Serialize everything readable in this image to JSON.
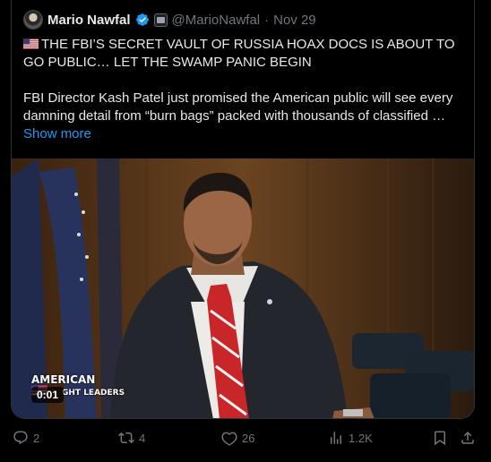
{
  "tweet": {
    "author_name": "Mario Nawfal",
    "handle": "@MarioNawfal",
    "separator": "·",
    "date": "Nov 29",
    "headline": "THE FBI’S SECRET VAULT OF RUSSIA HOAX DOCS IS ABOUT TO GO PUBLIC… LET THE SWAMP PANIC BEGIN",
    "paragraph": "FBI Director Kash Patel just promised the American public will see every damning detail from “burn bags” packed with thousands of classified …",
    "show_more": "Show more",
    "verified_icon": "verified-badge-icon",
    "affiliation_icon": "affiliation-badge-icon",
    "flag_icon": "us-flag-icon"
  },
  "video": {
    "timestamp": "0:01",
    "brand_line1": "AMERICAN",
    "brand_line2": "GHT LEADERS"
  },
  "actions": {
    "replies": "2",
    "reposts": "4",
    "likes": "26",
    "views": "1.2K"
  },
  "colors": {
    "background": "#000000",
    "text": "#e7e9ea",
    "muted": "#71767b",
    "link": "#1d9bf0",
    "border": "#2f3336"
  }
}
